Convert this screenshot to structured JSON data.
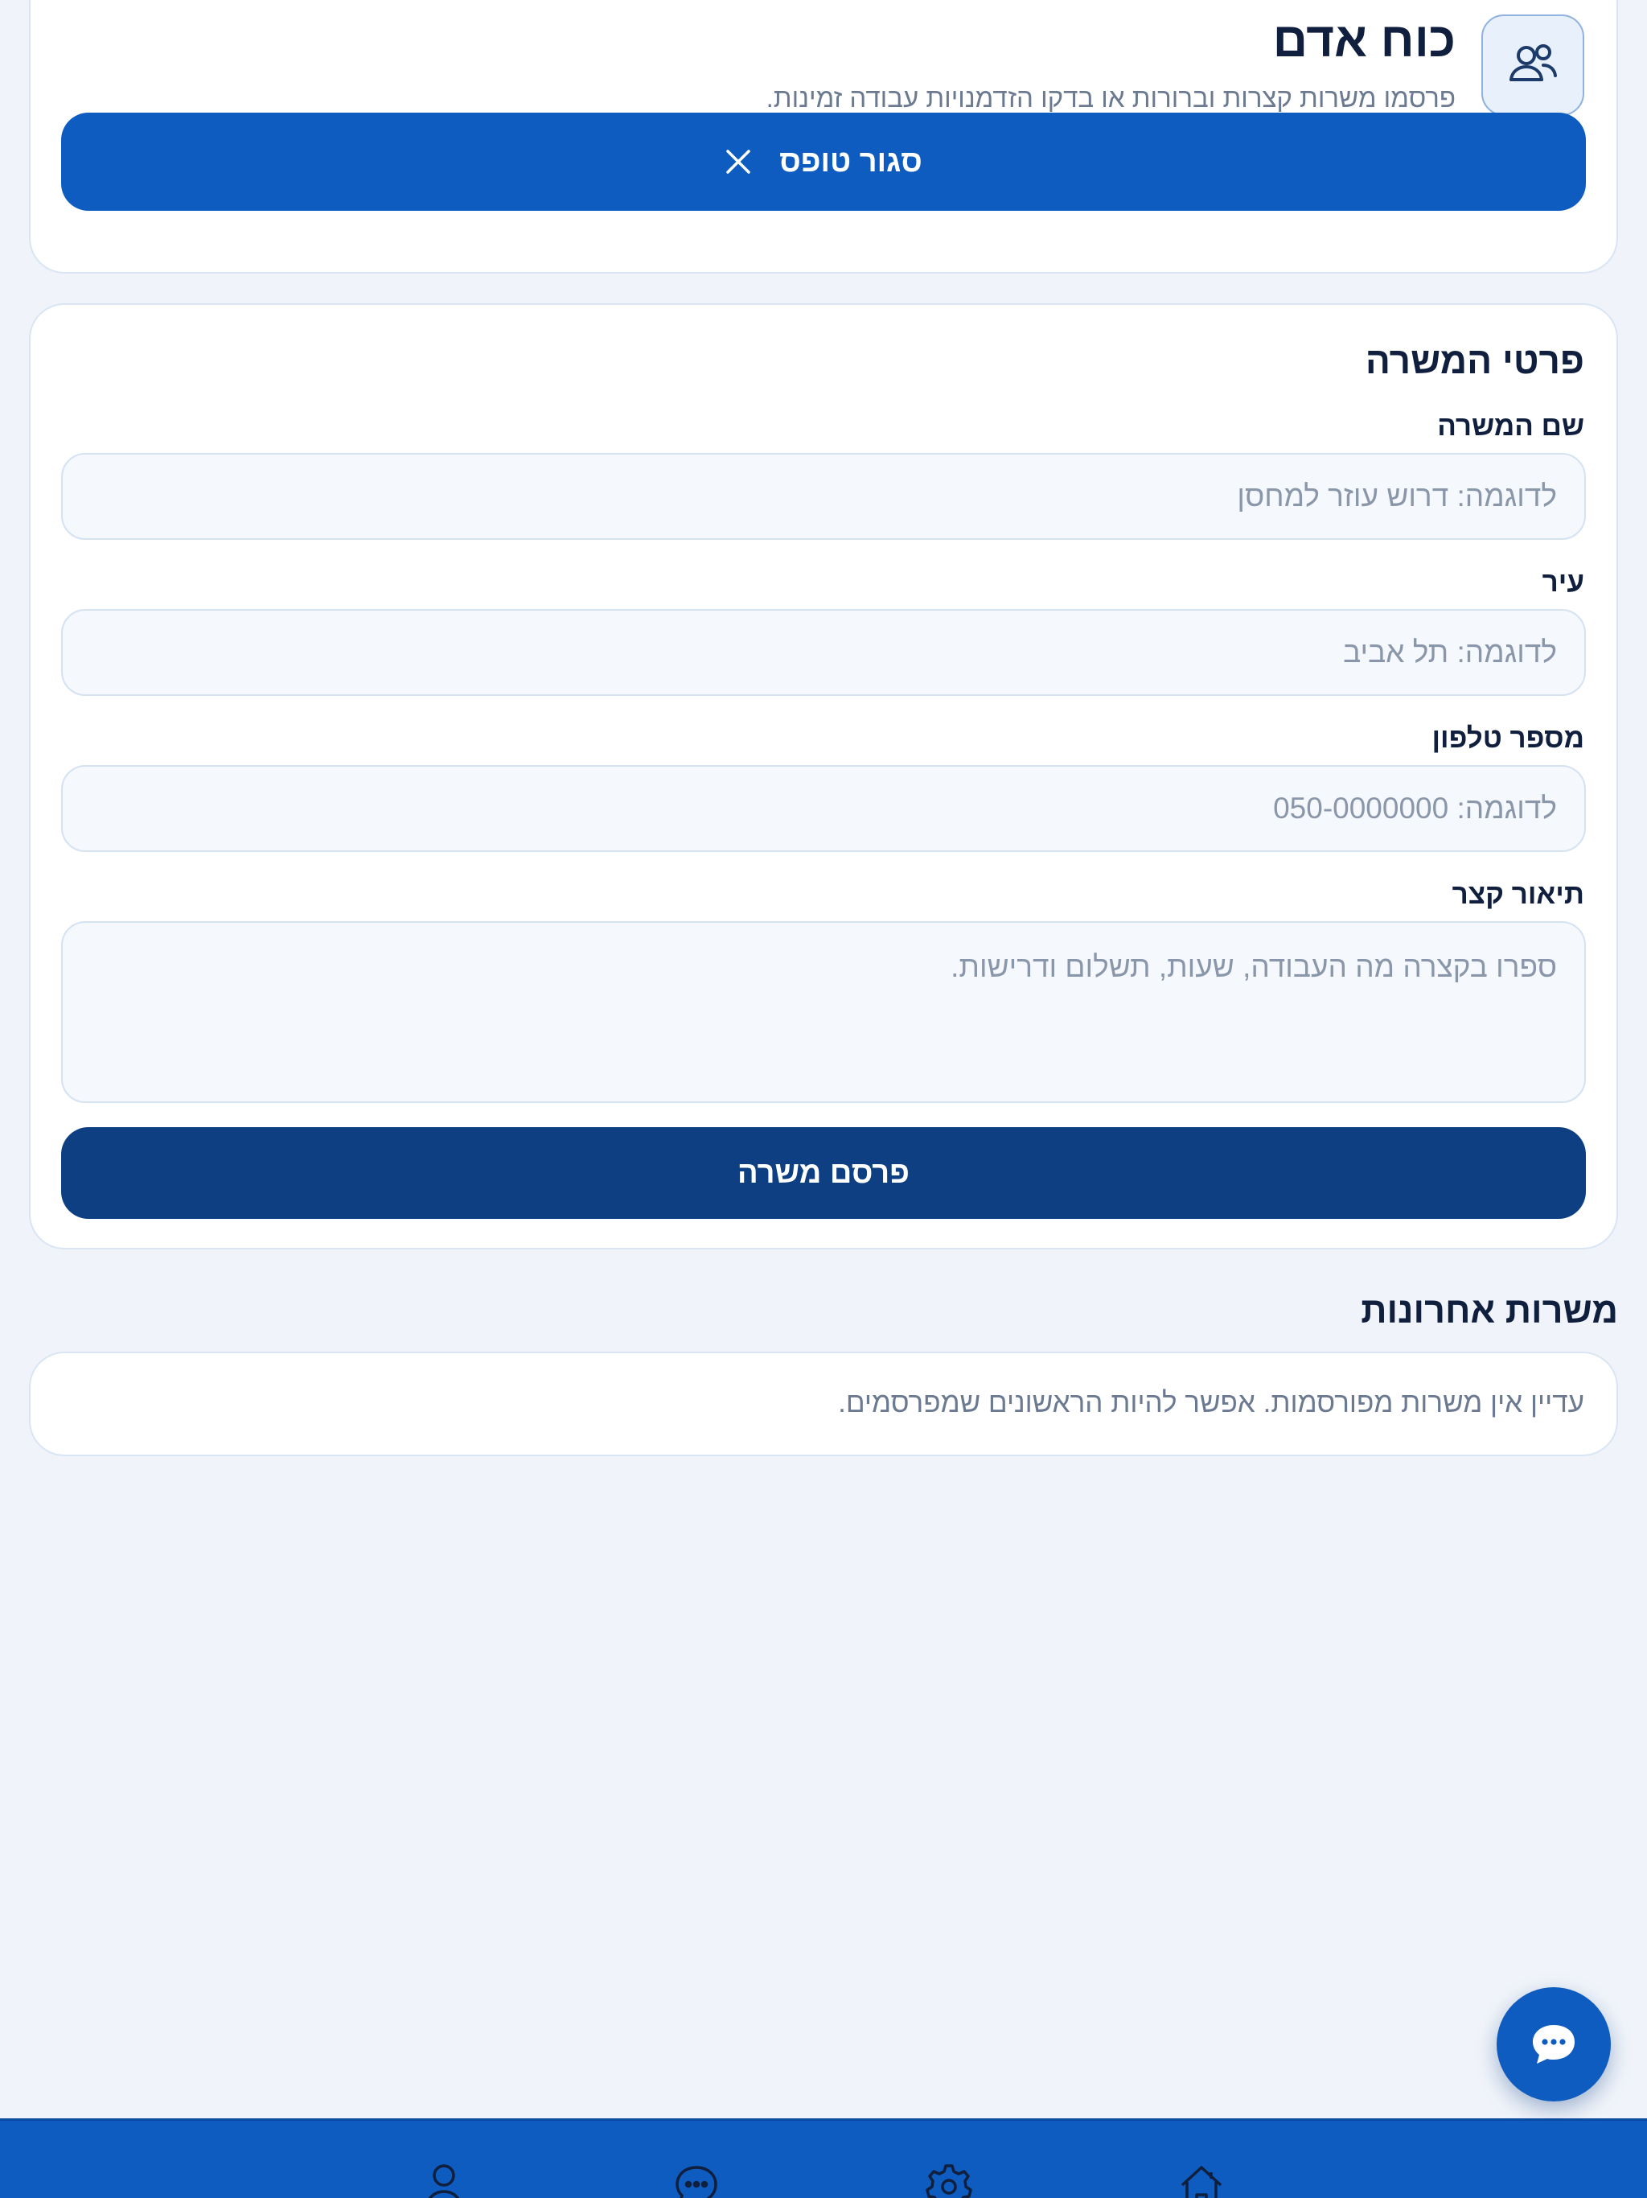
{
  "header": {
    "title": "כוח אדם",
    "subtitle": "פרסמו משרות קצרות וברורות או בדקו הזדמנויות עבודה זמינות.",
    "icon": "users-icon",
    "close_form_label": "סגור טופס"
  },
  "form": {
    "section_title": "פרטי המשרה",
    "job_title": {
      "label": "שם המשרה",
      "value": "",
      "placeholder": "לדוגמה: דרוש עוזר למחסן"
    },
    "city": {
      "label": "עיר",
      "value": "",
      "placeholder": "לדוגמה: תל אביב"
    },
    "phone": {
      "label": "מספר טלפון",
      "value": "",
      "placeholder": "לדוגמה: 050-0000000"
    },
    "description": {
      "label": "תיאור קצר",
      "value": "",
      "placeholder": "ספרו בקצרה מה העבודה, שעות, תשלום ודרישות."
    },
    "publish_label": "פרסם משרה"
  },
  "recent_jobs": {
    "title": "משרות אחרונות",
    "empty_message": "עדיין אין משרות מפורסמות. אפשר להיות הראשונים שמפרסמים."
  },
  "chat_fab": {
    "icon": "chat-bubble-icon"
  },
  "bottom_nav": {
    "items": [
      {
        "icon": "user-icon"
      },
      {
        "icon": "chat-icon"
      },
      {
        "icon": "gear-icon"
      },
      {
        "icon": "home-icon"
      }
    ]
  },
  "colors": {
    "primary": "#0f5cc0",
    "primary_dark": "#0e3f82",
    "background": "#f0f4fa",
    "text": "#0f1f3d",
    "muted_text": "#6b7a90"
  }
}
